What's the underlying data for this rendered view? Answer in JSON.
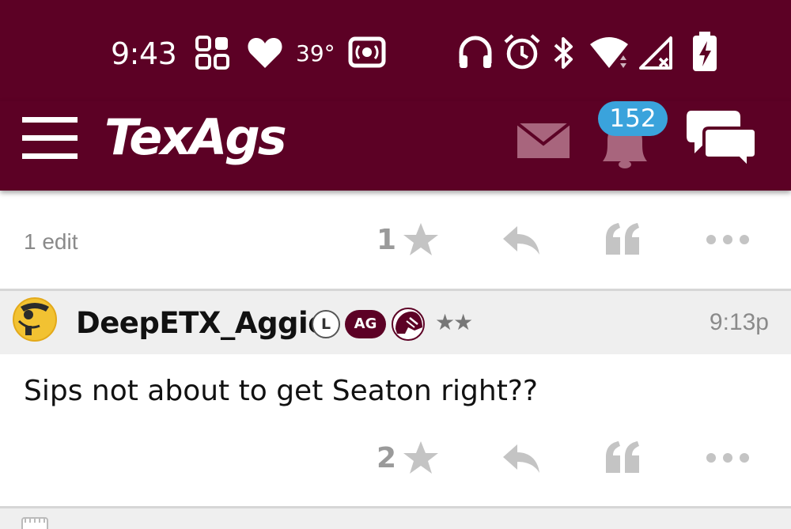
{
  "status_bar": {
    "time": "9:43",
    "temperature": "39°",
    "icons": [
      "grid-icon",
      "heart-icon",
      "radio-icon",
      "headphones-icon",
      "alarm-icon",
      "bluetooth-icon",
      "wifi-icon",
      "signal-icon",
      "battery-charging-icon"
    ]
  },
  "header": {
    "logo": "TexAgs",
    "notification_count": "152",
    "icons": [
      "menu-icon",
      "mail-icon",
      "bell-icon",
      "chat-icon"
    ]
  },
  "previous_post": {
    "edit_label": "1 edit",
    "star_count": "1"
  },
  "post": {
    "username": "DeepETX_Aggie",
    "badge_l": "L",
    "badge_ag": "AG",
    "rank": "★★",
    "time": "9:13p",
    "body": "Sips not about to get Seaton right??",
    "star_count": "2"
  },
  "colors": {
    "brand_maroon": "#5c0125",
    "badge_blue": "#3aa3dc",
    "icon_gray": "#c4c4c4",
    "muted_text": "#8a8a8a"
  }
}
